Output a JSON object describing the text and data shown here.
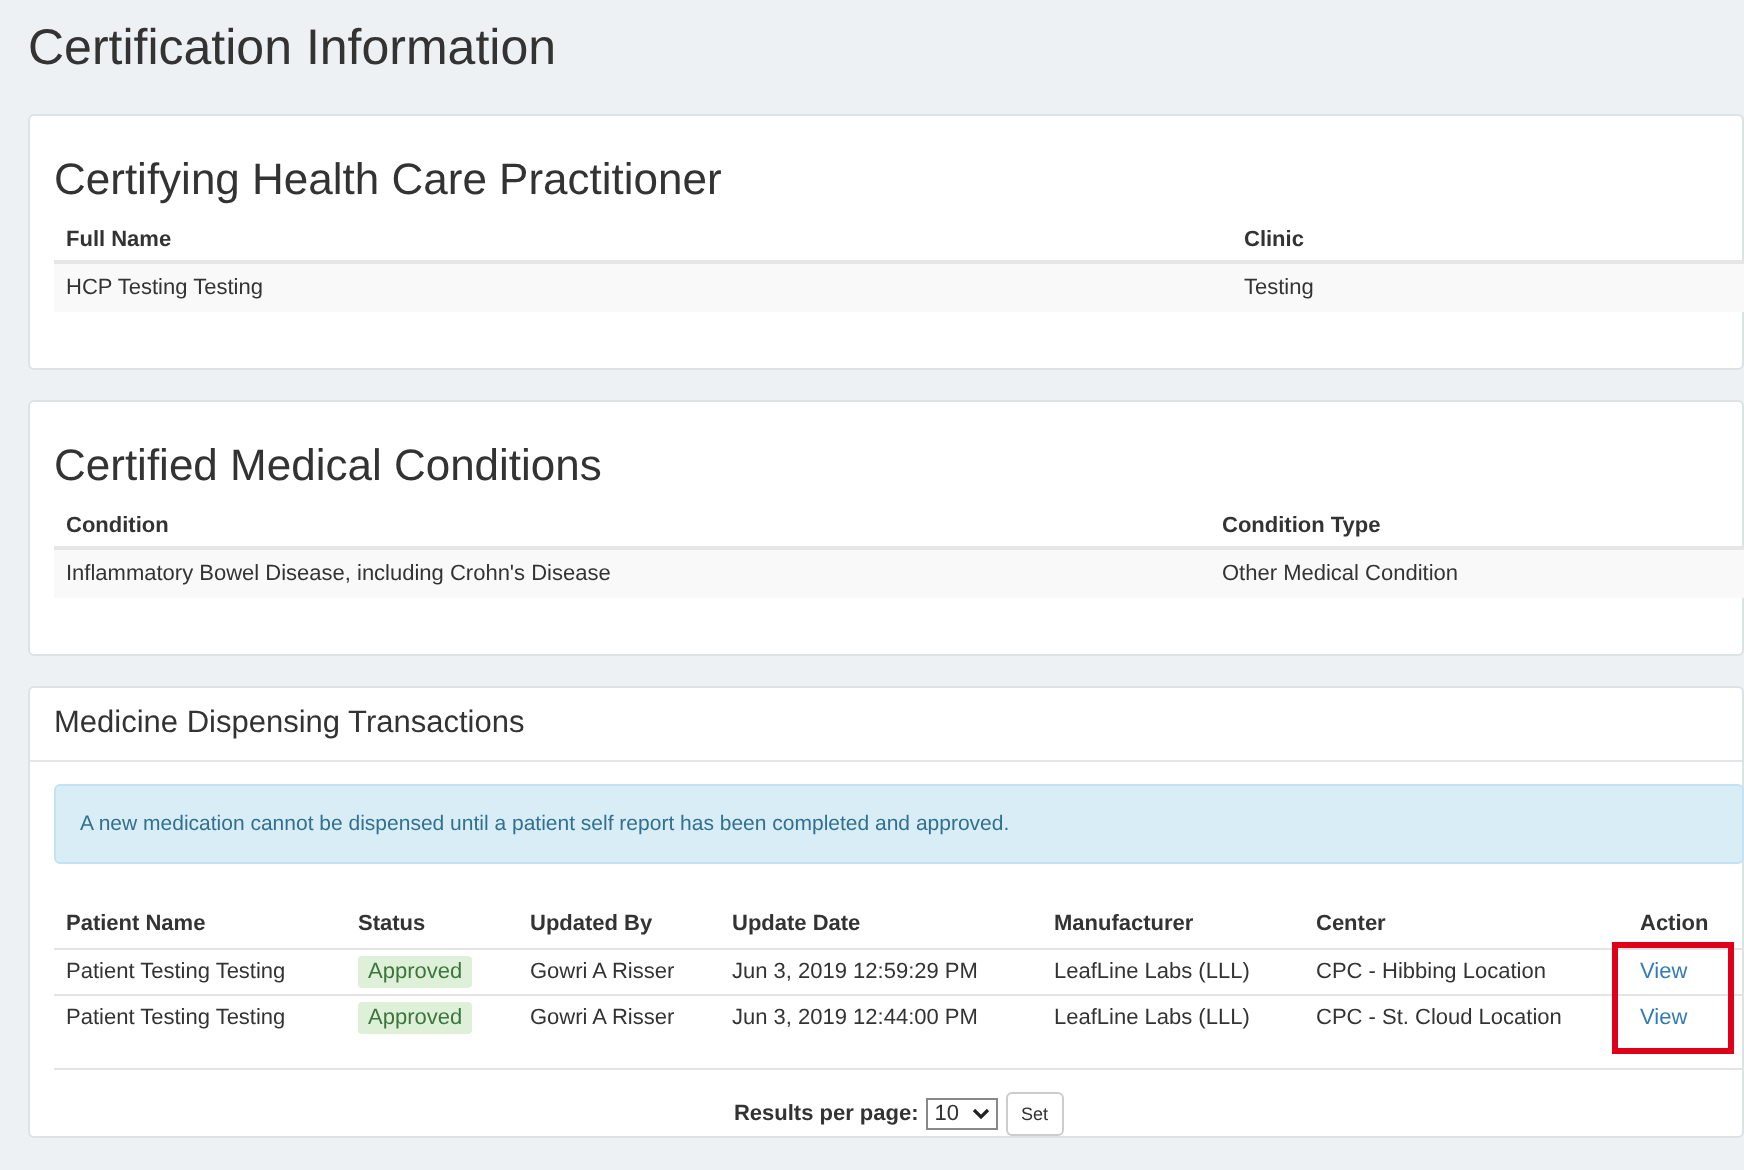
{
  "page_title": "Certification Information",
  "practitioner": {
    "title": "Certifying Health Care Practitioner",
    "columns": [
      "Full Name",
      "Clinic"
    ],
    "rows": [
      [
        "HCP Testing Testing",
        "Testing"
      ]
    ]
  },
  "conditions": {
    "title": "Certified Medical Conditions",
    "columns": [
      "Condition",
      "Condition Type"
    ],
    "rows": [
      [
        "Inflammatory Bowel Disease, including Crohn's Disease",
        "Other Medical Condition"
      ]
    ]
  },
  "transactions": {
    "title": "Medicine Dispensing Transactions",
    "alert": "A new medication cannot be dispensed until a patient self report has been completed and approved.",
    "columns": [
      "Patient Name",
      "Status",
      "Updated By",
      "Update Date",
      "Manufacturer",
      "Center",
      "Action"
    ],
    "rows": [
      {
        "patient": "Patient Testing Testing",
        "status": "Approved",
        "updated_by": "Gowri A Risser",
        "date": "Jun 3, 2019 12:59:29 PM",
        "manufacturer": "LeafLine Labs (LLL)",
        "center": "CPC - Hibbing Location",
        "action": "View"
      },
      {
        "patient": "Patient Testing Testing",
        "status": "Approved",
        "updated_by": "Gowri A Risser",
        "date": "Jun 3, 2019 12:44:00 PM",
        "manufacturer": "LeafLine Labs (LLL)",
        "center": "CPC - St. Cloud Location",
        "action": "View"
      }
    ],
    "action_highlight": true,
    "pagination": {
      "label": "Results per page:",
      "per_page": "10",
      "button": "Set"
    }
  }
}
